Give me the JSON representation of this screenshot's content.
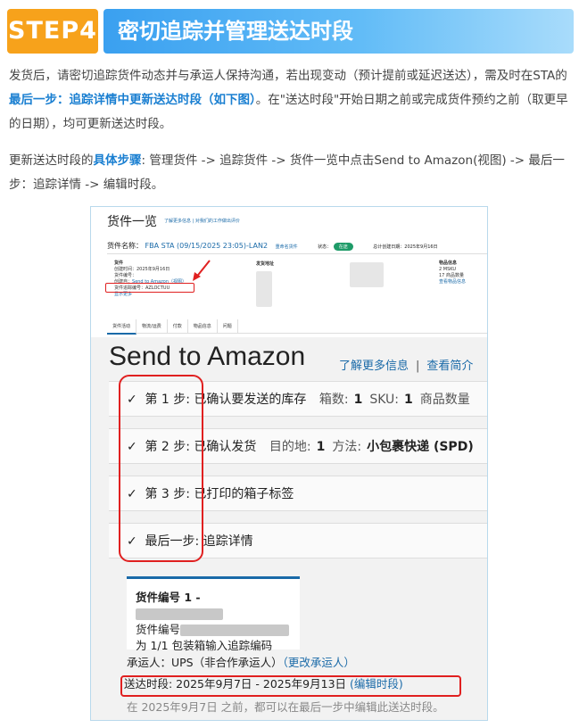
{
  "header": {
    "step_badge": "STEP4",
    "title": "密切追踪并管理送达时段"
  },
  "para1": {
    "text_a": "发货后，请密切追踪货件动态并与承运人保持沟通，若出现变动（预计提前或延迟送达），需及时在STA的",
    "highlight": "最后一步：追踪详情中更新送达时段（如下图）",
    "text_b": "。在\"送达时段\"开始日期之前或完成货件预约之前（取更早的日期），均可更新送达时段。"
  },
  "para2": {
    "text_a": "更新送达时段的",
    "highlight": "具体步骤",
    "text_b": ": 管理货件 -> 追踪货件 -> 货件一览中点击Send to Amazon(视图) -> 最后一步：追踪详情 -> 编辑时段。"
  },
  "small_top": {
    "title": "货件一览",
    "links": "了解更多信息  |  对我们的工作做出评价",
    "name_label": "货件名称：",
    "name_value": "FBA STA (09/15/2025 23:05)-LAN2",
    "rename": "重命名货件",
    "status_label": "状态：",
    "status_value": "在途",
    "created_label": "总计创建日期：2025年9月16日",
    "col1_head": "货件",
    "col1_line1": "创建时间：2025年9月16日",
    "col1_line2": "货件编号：",
    "col1_line3_label": "创建自：",
    "col1_line3_link": "Send to Amazon（视图）",
    "col1_line4": "货件追踪编号：AZLOCTUU",
    "col1_more": "显示更多",
    "col2_head": "发货地址",
    "col3_head": "物品信息",
    "col3_line1": "2 MSKU",
    "col3_line2": "17 商品数量",
    "col3_line3": "查看物品信息",
    "tabs": [
      "货件活动",
      "物流/运费",
      "付款",
      "物品信息",
      "问题"
    ]
  },
  "sta": {
    "title": "Send to Amazon",
    "link_more": "了解更多信息",
    "link_sep": "|",
    "link_overview": "查看简介",
    "check": "✓",
    "steps": [
      {
        "label": "第 1 步:",
        "desc": "已确认要发送的库存",
        "m1_label": "箱数:",
        "m1_value": "1",
        "m2_label": "SKU:",
        "m2_value": "1",
        "m3_label": "商品数量"
      },
      {
        "label": "第 2 步:",
        "desc": "已确认发货",
        "m1_label": "目的地:",
        "m1_value": "1",
        "m2_label": "方法:",
        "m2_value": "小包裹快递 (SPD)"
      },
      {
        "label": "第 3 步:",
        "desc": "已打印的箱子标签"
      },
      {
        "label": "最后一步:",
        "desc": "追踪详情"
      }
    ],
    "card_line1": "货件编号 1 -",
    "card_line2": "货件编号",
    "card_line3": "为 1/1 包装箱输入追踪编码",
    "carrier_label": "承运人：UPS（非合作承运人）",
    "carrier_link": "（更改承运人）",
    "window_label": "送达时段: 2025年9月7日 - 2025年9月13日",
    "window_link": "(编辑时段)",
    "note": "在 2025年9月7日 之前，都可以在最后一步中编辑此送达时段。"
  }
}
